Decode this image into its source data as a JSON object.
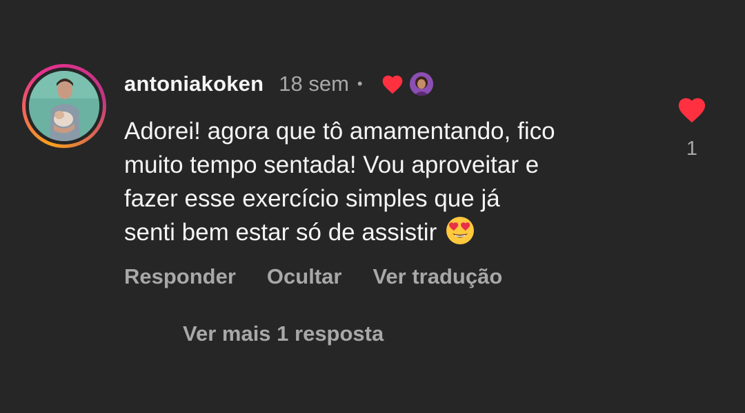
{
  "comment": {
    "username": "antoniakoken",
    "time": "18 sem",
    "separator": "•",
    "text_lines": [
      "Adorei! agora que tô amamentando, fico",
      "muito tempo sentada! Vou aproveitar e",
      "fazer esse exercício simples que já",
      "senti bem estar só de assistir"
    ],
    "emoji": "heart-eyes-emoji",
    "like_count": "1",
    "actions": {
      "reply": "Responder",
      "hide": "Ocultar",
      "translate": "Ver tradução"
    },
    "more_replies": "Ver mais 1 resposta"
  },
  "colors": {
    "background": "#262626",
    "heart": "#ff3040",
    "primary_text": "#f5f5f5",
    "secondary_text": "#a8a8a8"
  },
  "icons": {
    "like": "heart-icon",
    "creator_liked": "heart-icon",
    "avatar_ring": "story-ring"
  }
}
